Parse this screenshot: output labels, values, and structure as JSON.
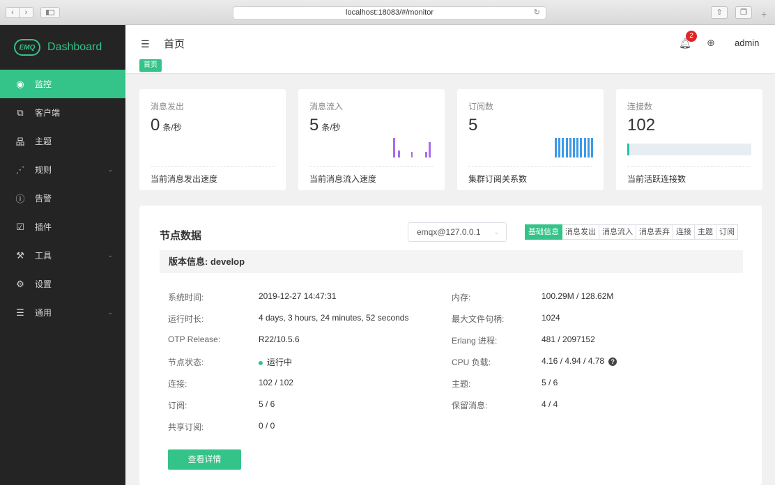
{
  "browser": {
    "url": "localhost:18083/#/monitor",
    "back_icon": "chevron-left-icon",
    "forward_icon": "chevron-right-icon"
  },
  "sidebar": {
    "brand_logo_text": "EMQ",
    "brand_title": "Dashboard",
    "items": [
      {
        "label": "监控",
        "icon": "gauge-icon",
        "active": true
      },
      {
        "label": "客户端",
        "icon": "clients-icon"
      },
      {
        "label": "主题",
        "icon": "topic-tree-icon"
      },
      {
        "label": "规则",
        "icon": "rule-icon",
        "expandable": true
      },
      {
        "label": "告警",
        "icon": "alarm-icon"
      },
      {
        "label": "插件",
        "icon": "plugin-icon"
      },
      {
        "label": "工具",
        "icon": "tools-icon",
        "expandable": true
      },
      {
        "label": "设置",
        "icon": "settings-icon"
      },
      {
        "label": "通用",
        "icon": "general-icon",
        "expandable": true
      }
    ]
  },
  "header": {
    "title": "首页",
    "breadcrumb": "首页",
    "notification_count": "2",
    "user": "admin"
  },
  "stats": [
    {
      "label": "消息发出",
      "value": "0",
      "unit": "条/秒",
      "footer": "当前消息发出速度"
    },
    {
      "label": "消息流入",
      "value": "5",
      "unit": "条/秒",
      "footer": "当前消息流入速度"
    },
    {
      "label": "订阅数",
      "value": "5",
      "unit": "",
      "footer": "集群订阅关系数"
    },
    {
      "label": "连接数",
      "value": "102",
      "unit": "",
      "footer": "当前活跃连接数"
    }
  ],
  "connection_ratio": 0.01,
  "node": {
    "title": "节点数据",
    "selected_node": "emqx@127.0.0.1",
    "tabs": [
      "基础信息",
      "消息发出",
      "消息流入",
      "消息丢弃",
      "连接",
      "主题",
      "订阅"
    ],
    "active_tab": "基础信息",
    "version_label": "版本信息: develop",
    "left_info": [
      {
        "label": "系统时间:",
        "value": "2019-12-27 14:47:31"
      },
      {
        "label": "运行时长:",
        "value": "4 days, 3 hours, 24 minutes, 52 seconds"
      },
      {
        "label": "OTP Release:",
        "value": "R22/10.5.6"
      },
      {
        "label": "节点状态:",
        "value": "运行中"
      },
      {
        "label": "连接:",
        "value": "102 / 102"
      },
      {
        "label": "订阅:",
        "value": "5 / 6"
      },
      {
        "label": "共享订阅:",
        "value": "0 / 0"
      }
    ],
    "right_info": [
      {
        "label": "内存:",
        "value": "100.29M / 128.62M"
      },
      {
        "label": "最大文件句柄:",
        "value": "1024"
      },
      {
        "label": "Erlang 进程:",
        "value": "481 / 2097152"
      },
      {
        "label": "CPU 负载:",
        "value": "4.16 / 4.94 / 4.78"
      },
      {
        "label": "主题:",
        "value": "5 / 6"
      },
      {
        "label": "保留消息:",
        "value": "4 / 4"
      }
    ],
    "detail_button": "查看详情"
  }
}
